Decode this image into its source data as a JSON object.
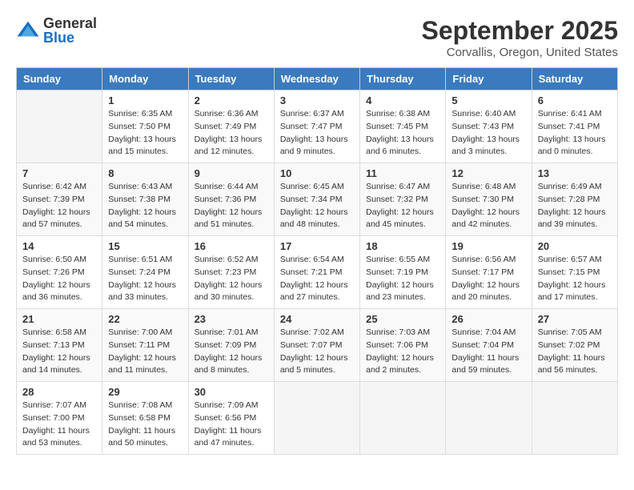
{
  "logo": {
    "general": "General",
    "blue": "Blue"
  },
  "title": {
    "month": "September 2025",
    "location": "Corvallis, Oregon, United States"
  },
  "weekdays": [
    "Sunday",
    "Monday",
    "Tuesday",
    "Wednesday",
    "Thursday",
    "Friday",
    "Saturday"
  ],
  "weeks": [
    [
      {
        "day": "",
        "info": ""
      },
      {
        "day": "1",
        "info": "Sunrise: 6:35 AM\nSunset: 7:50 PM\nDaylight: 13 hours\nand 15 minutes."
      },
      {
        "day": "2",
        "info": "Sunrise: 6:36 AM\nSunset: 7:49 PM\nDaylight: 13 hours\nand 12 minutes."
      },
      {
        "day": "3",
        "info": "Sunrise: 6:37 AM\nSunset: 7:47 PM\nDaylight: 13 hours\nand 9 minutes."
      },
      {
        "day": "4",
        "info": "Sunrise: 6:38 AM\nSunset: 7:45 PM\nDaylight: 13 hours\nand 6 minutes."
      },
      {
        "day": "5",
        "info": "Sunrise: 6:40 AM\nSunset: 7:43 PM\nDaylight: 13 hours\nand 3 minutes."
      },
      {
        "day": "6",
        "info": "Sunrise: 6:41 AM\nSunset: 7:41 PM\nDaylight: 13 hours\nand 0 minutes."
      }
    ],
    [
      {
        "day": "7",
        "info": "Sunrise: 6:42 AM\nSunset: 7:39 PM\nDaylight: 12 hours\nand 57 minutes."
      },
      {
        "day": "8",
        "info": "Sunrise: 6:43 AM\nSunset: 7:38 PM\nDaylight: 12 hours\nand 54 minutes."
      },
      {
        "day": "9",
        "info": "Sunrise: 6:44 AM\nSunset: 7:36 PM\nDaylight: 12 hours\nand 51 minutes."
      },
      {
        "day": "10",
        "info": "Sunrise: 6:45 AM\nSunset: 7:34 PM\nDaylight: 12 hours\nand 48 minutes."
      },
      {
        "day": "11",
        "info": "Sunrise: 6:47 AM\nSunset: 7:32 PM\nDaylight: 12 hours\nand 45 minutes."
      },
      {
        "day": "12",
        "info": "Sunrise: 6:48 AM\nSunset: 7:30 PM\nDaylight: 12 hours\nand 42 minutes."
      },
      {
        "day": "13",
        "info": "Sunrise: 6:49 AM\nSunset: 7:28 PM\nDaylight: 12 hours\nand 39 minutes."
      }
    ],
    [
      {
        "day": "14",
        "info": "Sunrise: 6:50 AM\nSunset: 7:26 PM\nDaylight: 12 hours\nand 36 minutes."
      },
      {
        "day": "15",
        "info": "Sunrise: 6:51 AM\nSunset: 7:24 PM\nDaylight: 12 hours\nand 33 minutes."
      },
      {
        "day": "16",
        "info": "Sunrise: 6:52 AM\nSunset: 7:23 PM\nDaylight: 12 hours\nand 30 minutes."
      },
      {
        "day": "17",
        "info": "Sunrise: 6:54 AM\nSunset: 7:21 PM\nDaylight: 12 hours\nand 27 minutes."
      },
      {
        "day": "18",
        "info": "Sunrise: 6:55 AM\nSunset: 7:19 PM\nDaylight: 12 hours\nand 23 minutes."
      },
      {
        "day": "19",
        "info": "Sunrise: 6:56 AM\nSunset: 7:17 PM\nDaylight: 12 hours\nand 20 minutes."
      },
      {
        "day": "20",
        "info": "Sunrise: 6:57 AM\nSunset: 7:15 PM\nDaylight: 12 hours\nand 17 minutes."
      }
    ],
    [
      {
        "day": "21",
        "info": "Sunrise: 6:58 AM\nSunset: 7:13 PM\nDaylight: 12 hours\nand 14 minutes."
      },
      {
        "day": "22",
        "info": "Sunrise: 7:00 AM\nSunset: 7:11 PM\nDaylight: 12 hours\nand 11 minutes."
      },
      {
        "day": "23",
        "info": "Sunrise: 7:01 AM\nSunset: 7:09 PM\nDaylight: 12 hours\nand 8 minutes."
      },
      {
        "day": "24",
        "info": "Sunrise: 7:02 AM\nSunset: 7:07 PM\nDaylight: 12 hours\nand 5 minutes."
      },
      {
        "day": "25",
        "info": "Sunrise: 7:03 AM\nSunset: 7:06 PM\nDaylight: 12 hours\nand 2 minutes."
      },
      {
        "day": "26",
        "info": "Sunrise: 7:04 AM\nSunset: 7:04 PM\nDaylight: 11 hours\nand 59 minutes."
      },
      {
        "day": "27",
        "info": "Sunrise: 7:05 AM\nSunset: 7:02 PM\nDaylight: 11 hours\nand 56 minutes."
      }
    ],
    [
      {
        "day": "28",
        "info": "Sunrise: 7:07 AM\nSunset: 7:00 PM\nDaylight: 11 hours\nand 53 minutes."
      },
      {
        "day": "29",
        "info": "Sunrise: 7:08 AM\nSunset: 6:58 PM\nDaylight: 11 hours\nand 50 minutes."
      },
      {
        "day": "30",
        "info": "Sunrise: 7:09 AM\nSunset: 6:56 PM\nDaylight: 11 hours\nand 47 minutes."
      },
      {
        "day": "",
        "info": ""
      },
      {
        "day": "",
        "info": ""
      },
      {
        "day": "",
        "info": ""
      },
      {
        "day": "",
        "info": ""
      }
    ]
  ]
}
